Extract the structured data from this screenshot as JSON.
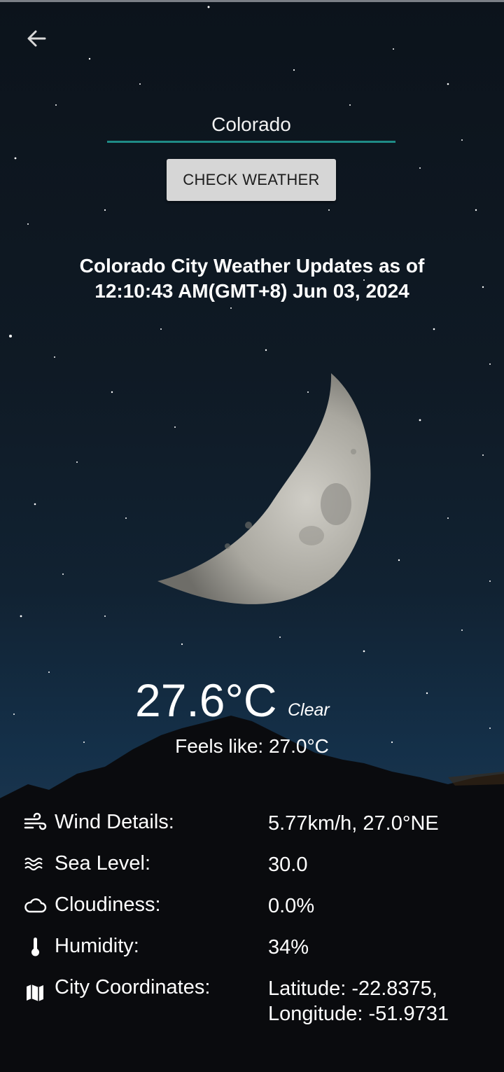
{
  "search": {
    "value": "Colorado",
    "placeholder": ""
  },
  "check_button": "CHECK WEATHER",
  "updates_heading": "Colorado City Weather Updates as of 12:10:43 AM(GMT+8) Jun 03, 2024",
  "current": {
    "temperature": "27.6°C",
    "condition": "Clear",
    "feels_like": "Feels like: 27.0°C"
  },
  "details": [
    {
      "icon": "wind-icon",
      "label": "Wind Details:",
      "value": "5.77km/h, 27.0°NE"
    },
    {
      "icon": "waves-icon",
      "label": "Sea Level:",
      "value": "30.0"
    },
    {
      "icon": "cloud-icon",
      "label": "Cloudiness:",
      "value": "0.0%"
    },
    {
      "icon": "thermometer-icon",
      "label": "Humidity:",
      "value": "34%"
    },
    {
      "icon": "map-icon",
      "label": "City Coordinates:",
      "value_line1": "Latitude: -22.8375,",
      "value_line2": "Longitude: -51.9731"
    }
  ],
  "colors": {
    "accent": "#1f8b86",
    "button_bg": "#d6d6d6",
    "background": "#0c131b"
  }
}
